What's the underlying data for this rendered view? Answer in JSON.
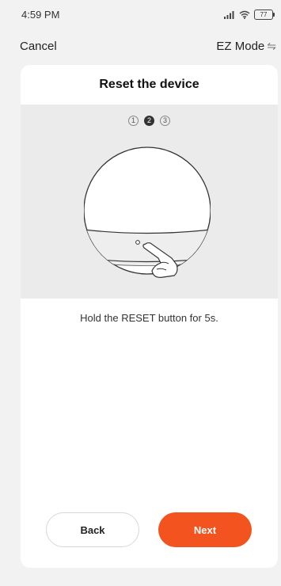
{
  "status_bar": {
    "time": "4:59 PM",
    "battery_level": "77",
    "icons": [
      "signal-icon",
      "wifi-icon",
      "battery-icon"
    ]
  },
  "nav": {
    "cancel_label": "Cancel",
    "mode_label": "EZ Mode",
    "mode_icon": "swap-arrows-icon"
  },
  "card": {
    "title": "Reset the device",
    "steps": [
      "1",
      "2",
      "3"
    ],
    "active_step": "2",
    "instruction": "Hold the RESET button for 5s."
  },
  "buttons": {
    "back_label": "Back",
    "next_label": "Next"
  },
  "colors": {
    "accent": "#f2531f",
    "background": "#f2f2f2",
    "card": "#ffffff",
    "illustration_bg": "#ebebeb"
  }
}
